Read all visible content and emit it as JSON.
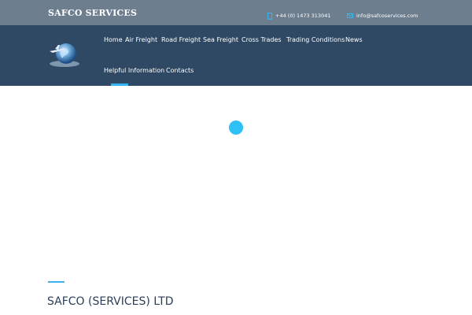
{
  "header": {
    "brand": "SAFCO SERVICES",
    "phone": "+44 (0) 1473 313041",
    "email": "info@safcoservices.com",
    "icons": {
      "phone": "phone-icon",
      "email": "mail-icon"
    }
  },
  "nav": {
    "items": [
      {
        "label": "Home"
      },
      {
        "label": "Air Freight"
      },
      {
        "label": "Road Freight"
      },
      {
        "label": "Sea Freight"
      },
      {
        "label": "Cross Trades"
      },
      {
        "label": "Trading Conditions"
      },
      {
        "label": "News"
      },
      {
        "label": "Helpful Information"
      },
      {
        "label": "Contacts"
      }
    ],
    "active": "Helpful Information"
  },
  "main": {
    "loading_indicator": "spinner",
    "title": "SAFCO (SERVICES) LTD"
  },
  "colors": {
    "topbar": "#6d7e8f",
    "navbar": "#2f4863",
    "accent": "#35b6f0",
    "title": "#2a3f5a"
  }
}
